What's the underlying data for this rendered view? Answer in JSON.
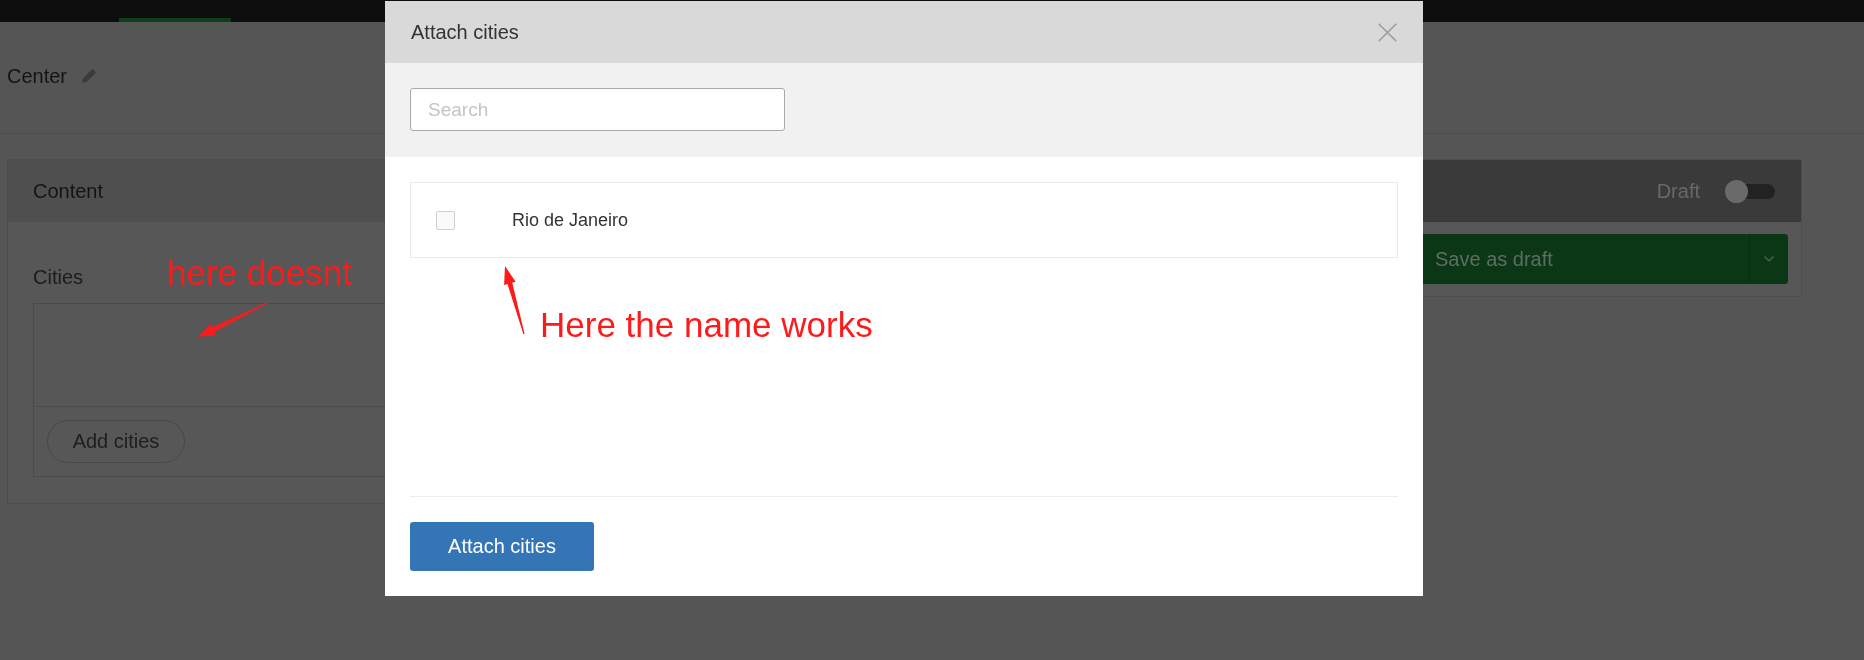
{
  "top_bar": {
    "tabs": [
      {
        "selected": true
      }
    ]
  },
  "page_header": {
    "title": "Center"
  },
  "content_card": {
    "title": "Content",
    "field": {
      "label": "Cities",
      "add_button": "Add cities"
    }
  },
  "publish_card": {
    "draft_toggle": {
      "label": "Draft",
      "on": false
    },
    "save_button": "Save as draft"
  },
  "modal": {
    "title": "Attach cities",
    "search": {
      "placeholder": "Search"
    },
    "items": [
      {
        "name": "Rio de Janeiro",
        "checked": false
      }
    ],
    "submit_button": "Attach cities"
  },
  "annotations": [
    {
      "text": "here doesnt"
    },
    {
      "text": "Here the name works"
    }
  ]
}
